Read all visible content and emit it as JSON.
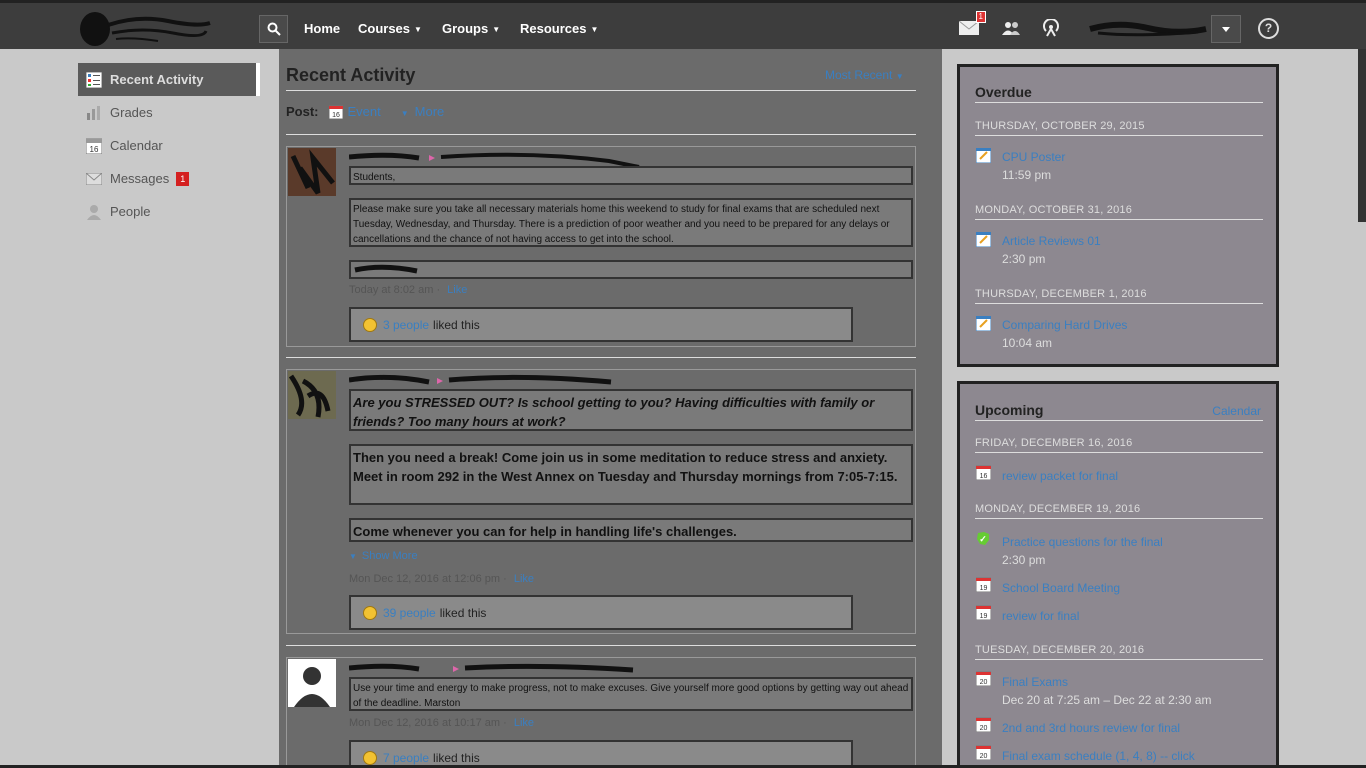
{
  "topbar": {
    "nav": [
      {
        "label": "Home",
        "has_caret": false
      },
      {
        "label": "Courses",
        "has_caret": true
      },
      {
        "label": "Groups",
        "has_caret": true
      },
      {
        "label": "Resources",
        "has_caret": true
      }
    ],
    "messages_badge": "1",
    "help_label": "?"
  },
  "sidebar": {
    "items": [
      {
        "label": "Recent Activity",
        "icon": "activity-icon",
        "active": true
      },
      {
        "label": "Grades",
        "icon": "grades-icon"
      },
      {
        "label": "Calendar",
        "icon": "calendar-icon"
      },
      {
        "label": "Messages",
        "icon": "envelope-icon",
        "badge": "1"
      },
      {
        "label": "People",
        "icon": "person-icon"
      }
    ]
  },
  "main": {
    "title": "Recent Activity",
    "sort_label": "Most Recent",
    "post_label": "Post:",
    "post_event_label": "Event",
    "post_more_label": "More",
    "feed": [
      {
        "messages": [
          "Students,",
          "Please make sure you take all necessary materials home this weekend to study for final exams that are scheduled next Tuesday, Wednesday, and Thursday.  There is a prediction of poor weather and you need to be prepared for any delays or cancellations and the chance of not having access to get into the school."
        ],
        "time": "Today at 8:02 am",
        "like_label": "Like",
        "likes_people": "3 people",
        "likes_suffix": "liked this"
      },
      {
        "messages": [
          "Are you STRESSED OUT?  Is school getting to you?  Having difficulties with family or friends?  Too many hours at work?",
          "Then you need a break!  Come join us in some meditation to reduce stress and anxiety.  Meet in room 292 in the West Annex on Tuesday and Thursday mornings from 7:05-7:15.",
          "Come whenever you can for help in handling life's challenges."
        ],
        "show_more": "Show More",
        "time": "Mon Dec 12, 2016 at 12:06 pm",
        "like_label": "Like",
        "likes_people": "39 people",
        "likes_suffix": "liked this"
      },
      {
        "messages": [
          "Use your time and energy to make progress, not to make excuses. Give yourself more good options by getting way out ahead of the deadline. Marston"
        ],
        "time": "Mon Dec 12, 2016 at 10:17 am",
        "like_label": "Like",
        "likes_people": "7 people",
        "likes_suffix": "liked this"
      }
    ]
  },
  "overdue": {
    "title": "Overdue",
    "groups": [
      {
        "date": "THURSDAY, OCTOBER 29, 2015",
        "items": [
          {
            "title": "CPU Poster",
            "time": "11:59 pm",
            "icon": "assignment-icon"
          }
        ]
      },
      {
        "date": "MONDAY, OCTOBER 31, 2016",
        "items": [
          {
            "title": "Article Reviews 01",
            "time": "2:30 pm",
            "icon": "assignment-icon"
          }
        ]
      },
      {
        "date": "THURSDAY, DECEMBER 1, 2016",
        "items": [
          {
            "title": "Comparing Hard Drives",
            "time": "10:04 am",
            "icon": "assignment-icon"
          }
        ]
      }
    ]
  },
  "upcoming": {
    "title": "Upcoming",
    "calendar_link": "Calendar",
    "groups": [
      {
        "date": "FRIDAY, DECEMBER 16, 2016",
        "items": [
          {
            "title": "review packet for final",
            "day": "16",
            "icon": "calendar-event-icon"
          }
        ]
      },
      {
        "date": "MONDAY, DECEMBER 19, 2016",
        "items": [
          {
            "title": "Practice questions for the final",
            "time": "2:30 pm",
            "icon": "quiz-icon"
          },
          {
            "title": "School Board Meeting",
            "day": "19",
            "icon": "calendar-event-icon"
          },
          {
            "title": "review for final",
            "day": "19",
            "icon": "calendar-event-icon"
          }
        ]
      },
      {
        "date": "TUESDAY, DECEMBER 20, 2016",
        "items": [
          {
            "title": "Final Exams",
            "time": "Dec 20 at 7:25 am – Dec 22 at 2:30 am",
            "day": "20",
            "icon": "calendar-event-icon"
          },
          {
            "title": "2nd and 3rd hours review for final",
            "day": "20",
            "icon": "calendar-event-icon"
          },
          {
            "title": "Final exam schedule (1, 4, 8) -- click",
            "day": "20",
            "icon": "calendar-event-icon"
          }
        ]
      }
    ]
  },
  "colors": {
    "topbar_bg": "#3d3d3d",
    "link": "#3a7fc1",
    "badge": "#d42020",
    "main_bg": "#6b6b6b",
    "panel_bg": "#8d8890"
  }
}
